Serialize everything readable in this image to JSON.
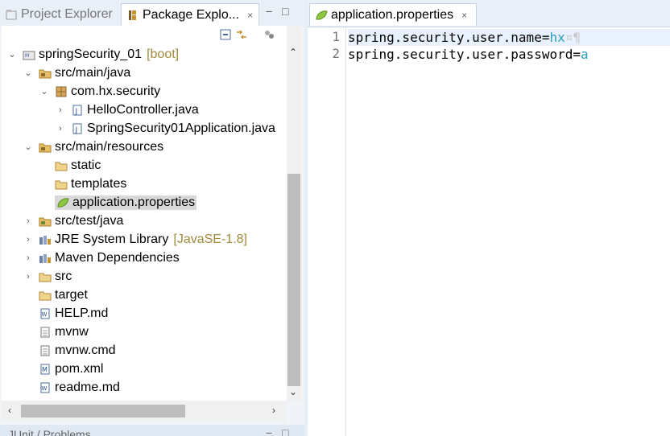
{
  "left_panel": {
    "tabs": [
      {
        "label": "Project Explorer"
      },
      {
        "label": "Package Explo..."
      }
    ],
    "tree": {
      "project": {
        "label": "springSecurity_01",
        "decoration": "[boot]"
      },
      "src_main_java": "src/main/java",
      "package": "com.hx.security",
      "file_hello": "HelloController.java",
      "file_app": "SpringSecurity01Application.java",
      "src_main_resources": "src/main/resources",
      "folder_static": "static",
      "folder_templates": "templates",
      "file_properties": "application.properties",
      "src_test_java": "src/test/java",
      "jre": {
        "label": "JRE System Library",
        "decoration": "[JavaSE-1.8]"
      },
      "maven": "Maven Dependencies",
      "src": "src",
      "target": "target",
      "help": "HELP.md",
      "mvnw": "mvnw",
      "mvnw_cmd": "mvnw.cmd",
      "pom": "pom.xml",
      "readme": "readme.md"
    },
    "bottom_tab": "JUnit / Problems"
  },
  "editor": {
    "tab_label": "application.properties",
    "lines": [
      {
        "number": "1",
        "key": "spring.security.user.name=",
        "value": "hx",
        "whitespace": "¤¶"
      },
      {
        "number": "2",
        "key": "spring.security.user.password=",
        "value": "a",
        "whitespace": ""
      }
    ]
  },
  "colors": {
    "background": "#e6eef8",
    "selection": "#d9d9d9",
    "value_text": "#2a9fbf",
    "decoration": "#a08a3c"
  },
  "icons": {
    "close": "×",
    "minimize": "−",
    "maximize": "□"
  }
}
